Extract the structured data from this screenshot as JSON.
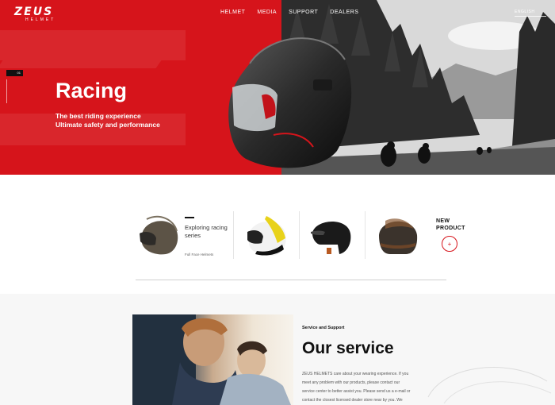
{
  "brand": {
    "logo": "ZEUS",
    "logo_sub": "HELMET"
  },
  "nav": {
    "items": [
      "HELMET",
      "MEDIA",
      "SUPPORT",
      "DEALERS"
    ],
    "language": "ENGLISH"
  },
  "hero": {
    "slide_index": "01",
    "title": "Racing",
    "subtitle_lines": [
      "The best riding experience",
      "Ultimate safety and performance"
    ]
  },
  "products": {
    "explore_title": "Exploring racing series",
    "category": "Full Face Helmets",
    "new_product_label": "NEW PRODUCT",
    "add_icon": "plus-icon",
    "items": [
      {
        "icon": "full-face-helmet-bronze-icon"
      },
      {
        "icon": "racing-helmet-yellow-icon"
      },
      {
        "icon": "open-face-helmet-black-icon"
      },
      {
        "icon": "jet-helmet-rust-icon"
      }
    ]
  },
  "service": {
    "label": "Service and Support",
    "title": "Our service",
    "body_lines": [
      "ZEUS HELMETS care about your wearing experience. If you",
      "meet any problem with our products, please contact our",
      "service center to better assist you. Please send us a e-mail or",
      "contact the closest licensed dealer store near by you. We"
    ]
  },
  "colors": {
    "brand_red": "#d6141b"
  }
}
